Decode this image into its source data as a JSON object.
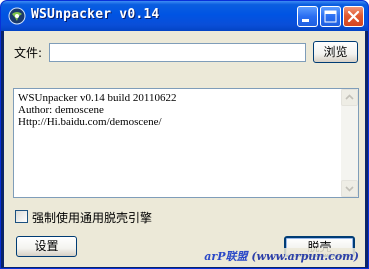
{
  "window": {
    "title": "WSUnpacker v0.14",
    "controls": {
      "minimize_icon": "minimize-icon",
      "maximize_icon": "maximize-icon",
      "close_icon": "close-icon"
    }
  },
  "file": {
    "label": "文件:",
    "value": "",
    "browse_label": "浏览"
  },
  "log": {
    "lines": "WSUnpacker v0.14 build 20110622\nAuthor: demoscene\nHttp://Hi.baidu.com/demoscene/"
  },
  "options": {
    "force_generic_label": "强制使用通用脱壳引擎",
    "force_generic_checked": false
  },
  "buttons": {
    "settings_label": "设置",
    "unpack_label": "脱壳"
  },
  "watermark": {
    "brand": "arP联盟",
    "url": "(www.arpun.com)"
  },
  "colors": {
    "titlebar": "#0054e3",
    "client_bg": "#ece9d8",
    "close_button": "#e25a32"
  }
}
